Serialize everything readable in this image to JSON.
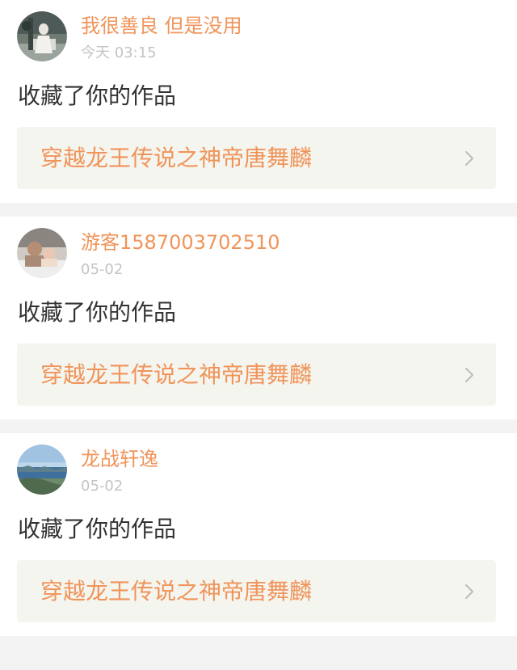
{
  "feed": [
    {
      "username": "我很善良 但是没用",
      "time": "今天 03:15",
      "action": "收藏了你的作品",
      "work_title": "穿越龙王传说之神帝唐舞麟",
      "avatar_icon": "avatar-photo-figure",
      "chevron_icon": "chevron-right-icon"
    },
    {
      "username": "游客1587003702510",
      "time": "05-02",
      "action": "收藏了你的作品",
      "work_title": "穿越龙王传说之神帝唐舞麟",
      "avatar_icon": "avatar-photo-people",
      "chevron_icon": "chevron-right-icon"
    },
    {
      "username": "龙战轩逸",
      "time": "05-02",
      "action": "收藏了你的作品",
      "work_title": "穿越龙王传说之神帝唐舞麟",
      "avatar_icon": "avatar-photo-seascape",
      "chevron_icon": "chevron-right-icon"
    }
  ],
  "colors": {
    "accent": "#f0945a",
    "muted": "#c4c4c4",
    "text": "#333333",
    "link_bg": "#f5f5ef",
    "page_bg": "#f3f3f3"
  }
}
